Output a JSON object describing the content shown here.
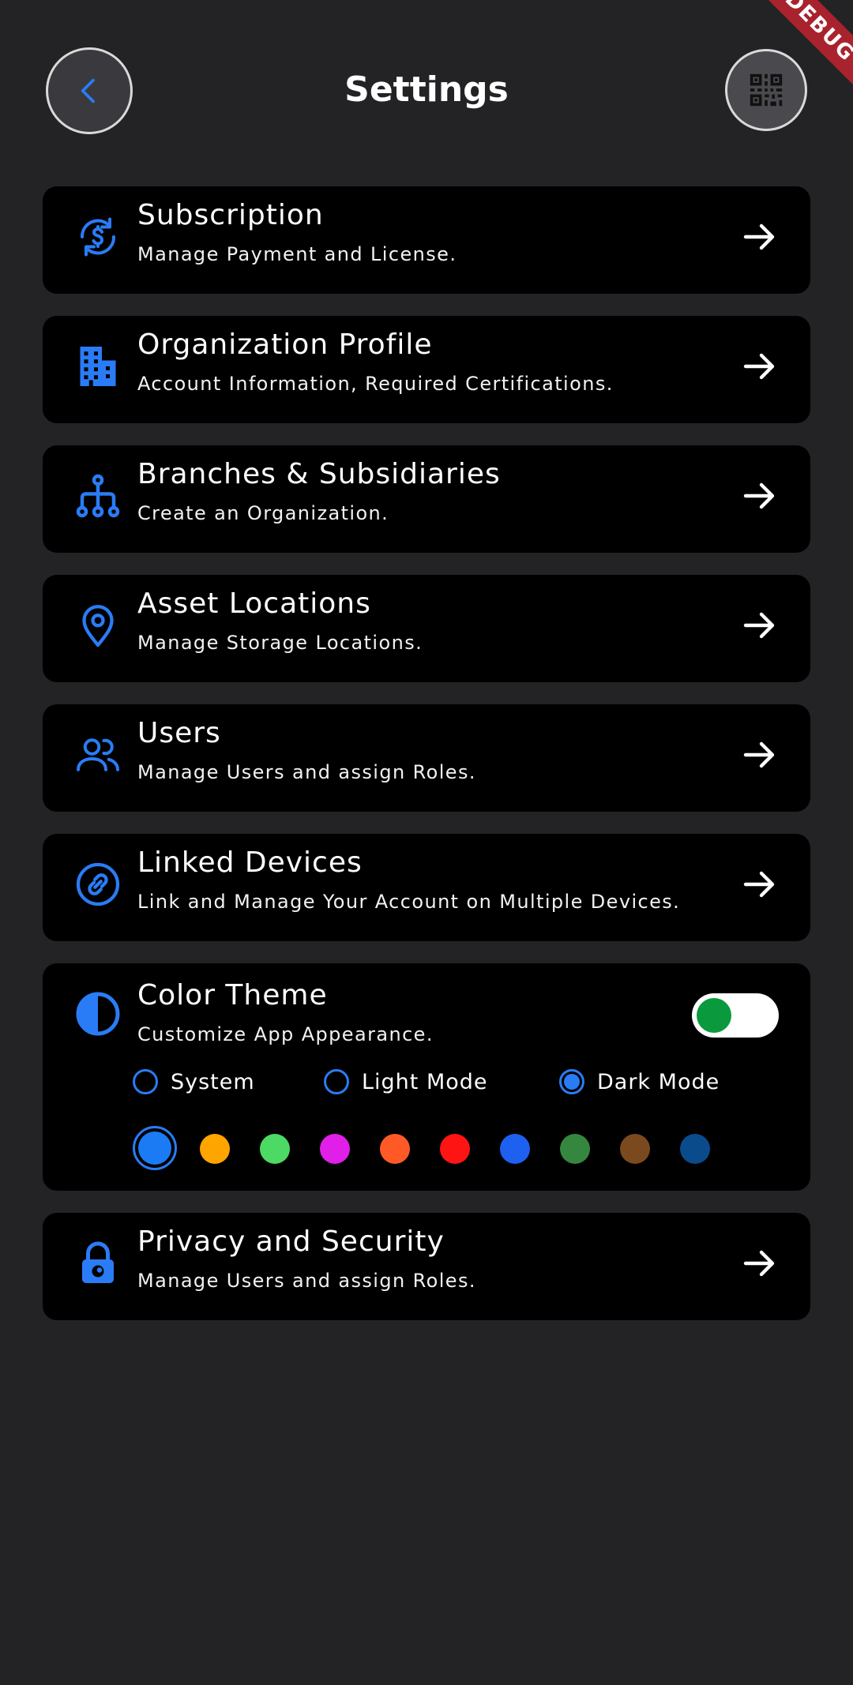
{
  "debug_banner": "DEBUG",
  "header": {
    "title": "Settings"
  },
  "accent_color": "#2a7cf6",
  "items": [
    {
      "title": "Subscription",
      "subtitle": "Manage Payment and License.",
      "icon": "currency-cycle-icon"
    },
    {
      "title": "Organization Profile",
      "subtitle": "Account Information, Required Certifications.",
      "icon": "building-icon"
    },
    {
      "title": "Branches & Subsidiaries",
      "subtitle": "Create an Organization.",
      "icon": "hierarchy-icon"
    },
    {
      "title": "Asset Locations",
      "subtitle": "Manage Storage Locations.",
      "icon": "location-pin-icon"
    },
    {
      "title": "Users",
      "subtitle": "Manage Users and assign Roles.",
      "icon": "users-icon"
    },
    {
      "title": "Linked Devices",
      "subtitle": "Link and Manage Your Account on Multiple Devices.",
      "icon": "link-icon"
    }
  ],
  "theme": {
    "title": "Color Theme",
    "subtitle": "Customize App Appearance.",
    "toggle_on": true,
    "modes": [
      {
        "label": "System",
        "selected": false
      },
      {
        "label": "Light Mode",
        "selected": false
      },
      {
        "label": "Dark Mode",
        "selected": true
      }
    ],
    "colors": [
      "#1a7bf5",
      "#ffa500",
      "#4cd964",
      "#e020e8",
      "#ff5a26",
      "#ff1414",
      "#1e60f0",
      "#35873f",
      "#7a4a1e",
      "#0a4b8c"
    ],
    "selected_color_index": 0
  },
  "privacy": {
    "title": "Privacy and Security",
    "subtitle": "Manage Users and assign Roles.",
    "icon": "lock-icon"
  }
}
